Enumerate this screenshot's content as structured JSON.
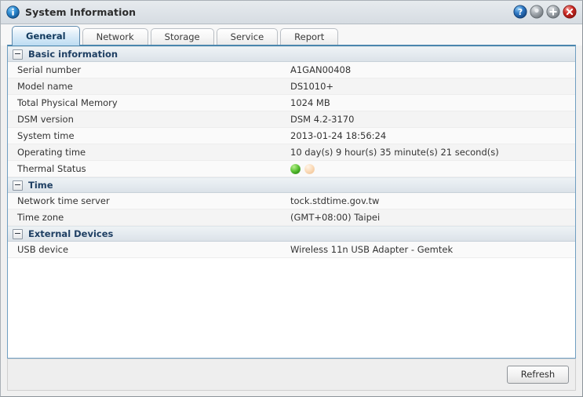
{
  "window": {
    "title": "System Information",
    "icon": "info-icon",
    "buttons": [
      {
        "name": "help-button",
        "glyph": "?",
        "color": "#2f78c4"
      },
      {
        "name": "minimize-button",
        "glyph": "-",
        "color": "#9aa0a6"
      },
      {
        "name": "maximize-button",
        "glyph": "+",
        "color": "#9aa0a6"
      },
      {
        "name": "close-button",
        "glyph": "x",
        "color": "#cf2b26"
      }
    ]
  },
  "tabs": [
    {
      "label": "General",
      "active": true
    },
    {
      "label": "Network",
      "active": false
    },
    {
      "label": "Storage",
      "active": false
    },
    {
      "label": "Service",
      "active": false
    },
    {
      "label": "Report",
      "active": false
    }
  ],
  "sections": [
    {
      "title": "Basic information",
      "rows": [
        {
          "label": "Serial number",
          "value": "A1GAN00408"
        },
        {
          "label": "Model name",
          "value": "DS1010+"
        },
        {
          "label": "Total Physical Memory",
          "value": "1024 MB"
        },
        {
          "label": "DSM version",
          "value": "DSM 4.2-3170"
        },
        {
          "label": "System time",
          "value": "2013-01-24 18:56:24"
        },
        {
          "label": "Operating time",
          "value": "10 day(s) 9 hour(s) 35 minute(s) 21 second(s)"
        },
        {
          "label": "Thermal Status",
          "value": "",
          "leds": [
            "green",
            "peach"
          ]
        }
      ]
    },
    {
      "title": "Time",
      "rows": [
        {
          "label": "Network time server",
          "value": "tock.stdtime.gov.tw"
        },
        {
          "label": "Time zone",
          "value": "(GMT+08:00) Taipei"
        }
      ]
    },
    {
      "title": "External Devices",
      "rows": [
        {
          "label": "USB device",
          "value": "Wireless 11n USB Adapter - Gemtek"
        }
      ]
    }
  ],
  "footer": {
    "refresh_label": "Refresh"
  },
  "colors": {
    "accent": "#4a86ad",
    "section_text": "#1f3f63",
    "led_green": "#62c63b",
    "led_peach": "#fbdcbb",
    "close_red": "#cf2b26"
  }
}
